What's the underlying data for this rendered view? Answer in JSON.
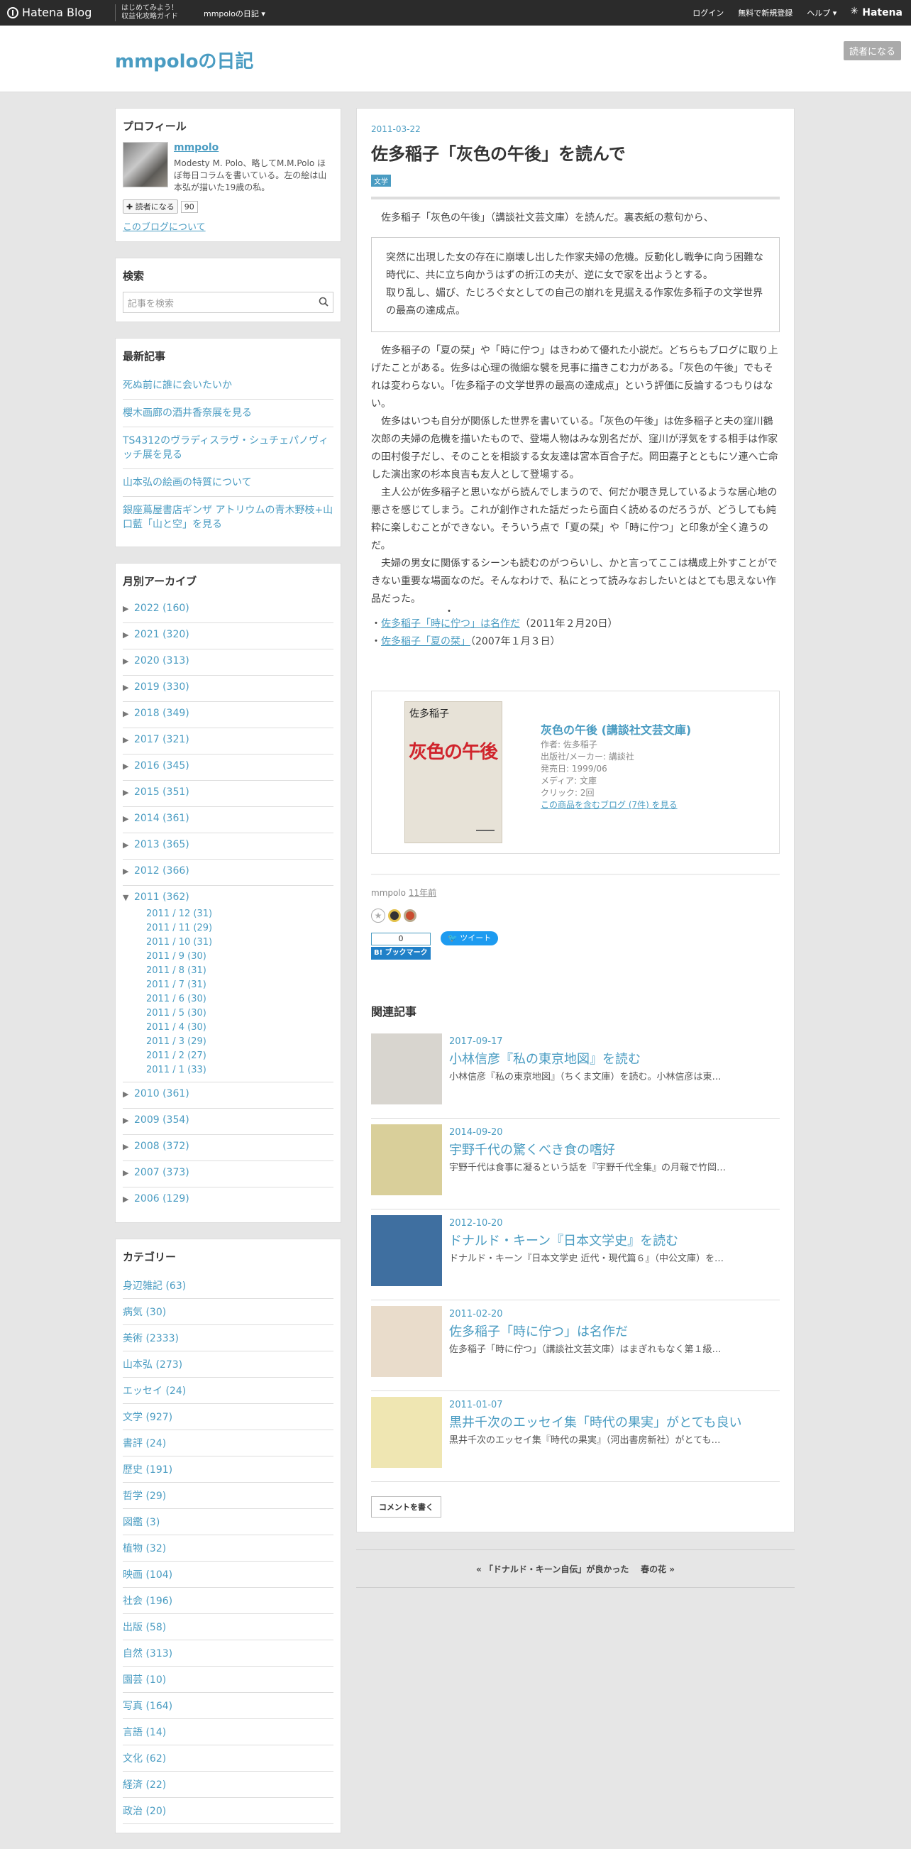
{
  "globalbar": {
    "logo": "Hatena Blog",
    "guide_line1": "はじめてみよう！",
    "guide_line2": "収益化攻略ガイド",
    "blog_menu": "mmpoloの日記 ▾",
    "login": "ログイン",
    "signup": "無料で新規登録",
    "help": "ヘルプ ▾",
    "hatena": "Hatena"
  },
  "header": {
    "blog_title": "mmpoloの日記",
    "reader_button": "読者になる"
  },
  "profile": {
    "heading": "プロフィール",
    "name": "mmpolo",
    "description": "Modesty M. Polo、略してM.M.Polo ほぼ毎日コラムを書いている。左の絵は山本弘が描いた19歳の私。",
    "reader_button": "✚ 読者になる",
    "reader_count": "90",
    "about_link": "このブログについて"
  },
  "search": {
    "heading": "検索",
    "placeholder": "記事を検索"
  },
  "recent": {
    "heading": "最新記事",
    "items": [
      "死ぬ前に誰に会いたいか",
      "櫻木画廊の酒井香奈展を見る",
      "TS4312のヴラディスラヴ・シュチェパノヴィッチ展を見る",
      "山本弘の絵画の特質について",
      "銀座蔦屋書店ギンザ アトリウムの青木野枝+山口藍「山と空」を見る"
    ]
  },
  "archive": {
    "heading": "月別アーカイブ",
    "years_before": [
      "2022 (160)",
      "2021 (320)",
      "2020 (313)",
      "2019 (330)",
      "2018 (349)",
      "2017 (321)",
      "2016 (345)",
      "2015 (351)",
      "2014 (361)",
      "2013 (365)",
      "2012 (366)"
    ],
    "open_year": "2011 (362)",
    "months": [
      "2011 / 12 (31)",
      "2011 / 11 (29)",
      "2011 / 10 (31)",
      "2011 / 9 (30)",
      "2011 / 8 (31)",
      "2011 / 7 (31)",
      "2011 / 6 (30)",
      "2011 / 5 (30)",
      "2011 / 4 (30)",
      "2011 / 3 (29)",
      "2011 / 2 (27)",
      "2011 / 1 (33)"
    ],
    "years_after": [
      "2010 (361)",
      "2009 (354)",
      "2008 (372)",
      "2007 (373)",
      "2006 (129)"
    ]
  },
  "categories": {
    "heading": "カテゴリー",
    "items": [
      "身辺雑記 (63)",
      "病気 (30)",
      "美術 (2333)",
      "山本弘 (273)",
      "エッセイ (24)",
      "文学 (927)",
      "書評 (24)",
      "歴史 (191)",
      "哲学 (29)",
      "図鑑 (3)",
      "植物 (32)",
      "映画 (104)",
      "社会 (196)",
      "出版 (58)",
      "自然 (313)",
      "園芸 (10)",
      "写真 (164)",
      "言語 (14)",
      "文化 (62)",
      "経済 (22)",
      "政治 (20)"
    ]
  },
  "entry": {
    "date": "2011-03-22",
    "title": "佐多稲子「灰色の午後」を読んで",
    "category": "文学",
    "intro": "佐多稲子「灰色の午後」（講談社文芸文庫）を読んだ。裏表紙の惹句から、",
    "quote_p1": "突然に出現した女の存在に崩壊し出した作家夫婦の危機。反動化し戦争に向う困難な時代に、共に立ち向かうはずの折江の夫が、逆に女で家を出ようとする。",
    "quote_p2": "取り乱し、媚び、たじろぐ女としての自己の崩れを見据える作家佐多稲子の文学世界の最高の達成点。",
    "body_p1": "佐多稲子の「夏の栞」や「時に佇つ」はきわめて優れた小説だ。どちらもブログに取り上げたことがある。佐多は心理の微細な襞を見事に描きこむ力がある。「灰色の午後」でもそれは変わらない。「佐多稲子の文学世界の最高の達成点」という評価に反論するつもりはない。",
    "body_p2": "佐多はいつも自分が関係した世界を書いている。「灰色の午後」は佐多稲子と夫の窪川鶴次郎の夫婦の危機を描いたもので、登場人物はみな別名だが、窪川が浮気をする相手は作家の田村俊子だし、そのことを相談する女友達は宮本百合子だ。岡田嘉子とともにソ連へ亡命した演出家の杉本良吉も友人として登場する。",
    "body_p3": "主人公が佐多稲子と思いながら読んでしまうので、何だか覗き見しているような居心地の悪さを感じてしまう。これが創作された話だったら面白く読めるのだろうが、どうしても純粋に楽しむことができない。そういう点で「夏の栞」や「時に佇つ」と印象が全く違うのだ。",
    "body_p4": "夫婦の男女に関係するシーンも読むのがつらいし、かと言ってここは構成上外すことができない重要な場面なのだ。そんなわけで、私にとって読みなおしたいとはとても思えない作品だった。",
    "dot": "・",
    "link1_prefix": "・",
    "link1": "佐多稲子「時に佇つ」は名作だ",
    "link1_date": "（2011年２月20日）",
    "link2_prefix": "・",
    "link2": "佐多稲子「夏の栞」",
    "link2_date": "（2007年１月３日）"
  },
  "product": {
    "cover_author": "佐多稲子",
    "cover_title": "灰色の午後",
    "title": "灰色の午後 (講談社文芸文庫)",
    "author": "作者: 佐多稲子",
    "publisher": "出版社/メーカー: 講談社",
    "release": "発売日: 1999/06",
    "media": "メディア: 文庫",
    "clicks": "クリック: 2回",
    "blogs_link": "この商品を含むブログ (7件) を見る"
  },
  "entry_footer": {
    "author": "mmpolo",
    "time": "11年前",
    "hb_count": "0",
    "hb_label": "B! ブックマーク",
    "tweet": "🐦 ツイート"
  },
  "related": {
    "heading": "関連記事",
    "items": [
      {
        "date": "2017-09-17",
        "title": "小林信彦『私の東京地図』を読む",
        "desc": "小林信彦『私の東京地図』（ちくま文庫）を読む。小林信彦は東…",
        "thumb": "#d8d5cf"
      },
      {
        "date": "2014-09-20",
        "title": "宇野千代の驚くべき食の嗜好",
        "desc": "宇野千代は食事に凝るという話を『宇野千代全集』の月報で竹岡…",
        "thumb": "#d9cf9a"
      },
      {
        "date": "2012-10-20",
        "title": "ドナルド・キーン『日本文学史』を読む",
        "desc": "ドナルド・キーン『日本文学史 近代・現代篇６』（中公文庫）を…",
        "thumb": "#3f6fa0"
      },
      {
        "date": "2011-02-20",
        "title": "佐多稲子「時に佇つ」は名作だ",
        "desc": "佐多稲子「時に佇つ」（講談社文芸文庫）はまぎれもなく第１級…",
        "thumb": "#e9dccb"
      },
      {
        "date": "2011-01-07",
        "title": "黒井千次のエッセイ集「時代の果実」がとても良い",
        "desc": "黒井千次のエッセイ集『時代の果実』（河出書房新社）がとても…",
        "thumb": "#efe6b2"
      }
    ]
  },
  "comment_button": "コメントを書く",
  "pager": {
    "prev": "« 「ドナルド・キーン自伝」が良かった",
    "next": "春の花 »"
  }
}
